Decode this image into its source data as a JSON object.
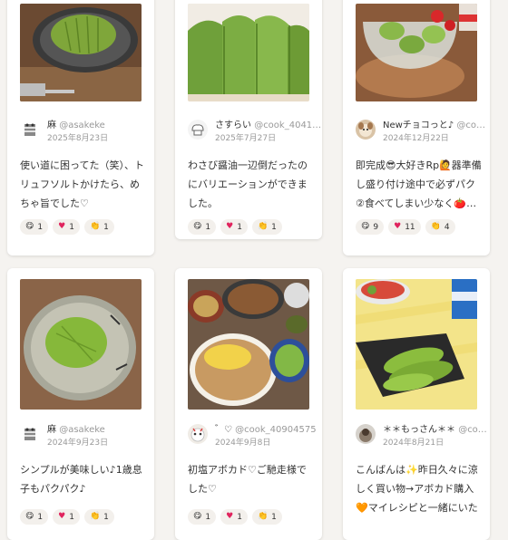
{
  "cards": [
    {
      "name": "麻",
      "handle": "@asakeke",
      "date": "2025年8月23日",
      "text": "使い道に困ってた（笑）、トリュフソルトかけたら、めちゃ旨でした♡",
      "reactions": [
        "1",
        "1",
        "1"
      ]
    },
    {
      "name": "さすらい",
      "handle": "@cook_4041…",
      "date": "2025年7月27日",
      "text": "わさび醤油一辺倒だったのにバリエーションができました。",
      "reactions": [
        "1",
        "1",
        "1"
      ]
    },
    {
      "name": "Newチョコっと♪",
      "handle": "@co…",
      "date": "2024年12月22日",
      "text": "即完成😎大好きRp🙋器準備し盛り付け途中で必ずパク②食べてしまい少なく🍅…",
      "reactions": [
        "9",
        "11",
        "4"
      ]
    },
    {
      "name": "麻",
      "handle": "@asakeke",
      "date": "2024年9月23日",
      "text": "シンプルが美味しい♪1歳息子もパクパク♪",
      "reactions": [
        "1",
        "1",
        "1"
      ]
    },
    {
      "name": "゛♡",
      "handle": "@cook_40904575",
      "date": "2024年9月8日",
      "text": "初塩アボカド♡ご馳走様でした♡",
      "reactions": [
        "1",
        "1",
        "1"
      ]
    },
    {
      "name": "＊＊もっさん＊＊",
      "handle": "@co…",
      "date": "2024年8月21日",
      "text": "こんばんは✨昨日久々に涼しく買い物→アボカド購入🧡マイレシピと一緒にいただき…",
      "reactions": [
        "",
        "",
        ""
      ]
    }
  ],
  "reaction_icons": [
    "yum-face-icon",
    "heart-icon",
    "clap-icon"
  ],
  "colors": {
    "avocado": "#6f9a34",
    "heart": "#e0245e",
    "background": "#f5f3f0"
  }
}
